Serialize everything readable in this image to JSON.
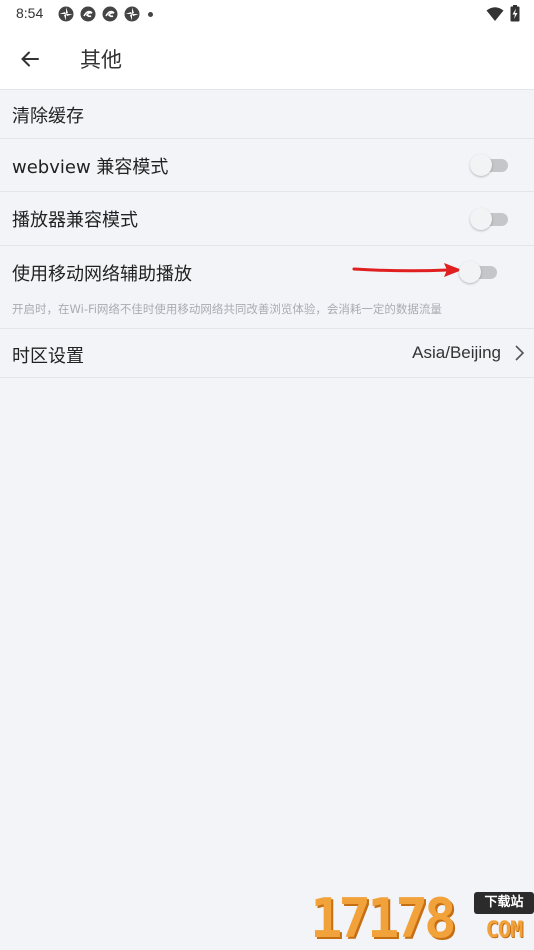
{
  "status_bar": {
    "time": "8:54",
    "notification_icons": [
      "aperture-icon",
      "swirl-icon",
      "swirl-icon",
      "aperture-icon"
    ],
    "right_icons": [
      "wifi-icon",
      "battery-charging-icon"
    ]
  },
  "app_bar": {
    "back_icon": "arrow-left-icon",
    "title": "其他"
  },
  "settings": {
    "clear_cache": {
      "label": "清除缓存"
    },
    "webview_compat": {
      "label": "webview 兼容模式",
      "enabled": false
    },
    "player_compat": {
      "label": "播放器兼容模式",
      "enabled": false
    },
    "mobile_assist": {
      "label": "使用移动网络辅助播放",
      "description": "开启时，在Wi-Fi网络不佳时使用移动网络共同改善浏览体验，会消耗一定的数据流量",
      "enabled": false
    },
    "timezone": {
      "label": "时区设置",
      "value": "Asia/Beijing"
    }
  },
  "watermark": {
    "digits": "17178",
    "badge": "下载站",
    "suffix": "COM"
  },
  "colors": {
    "background": "#f2f4f8",
    "toggle_track": "#c4c6c9",
    "toggle_thumb": "#f2f3f5",
    "annotation_arrow": "#e02020",
    "watermark": "#f2a23a"
  }
}
